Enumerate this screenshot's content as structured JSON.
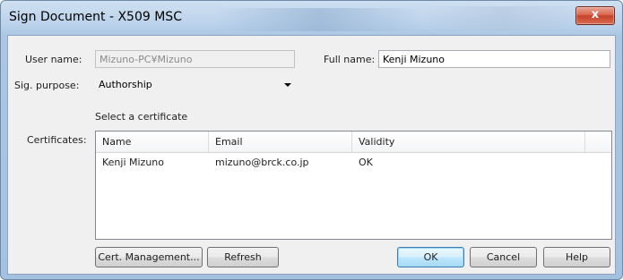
{
  "window": {
    "title": "Sign Document - X509 MSC",
    "close_glyph": "x"
  },
  "form": {
    "user_name_label": "User name:",
    "user_name_value": "Mizuno-PC¥Mizuno",
    "full_name_label": "Full name:",
    "full_name_value": "Kenji Mizuno",
    "sig_purpose_label": "Sig. purpose:",
    "sig_purpose_value": "Authorship",
    "select_certificate_label": "Select a certificate",
    "certificates_label": "Certificates:"
  },
  "certificates": {
    "columns": [
      "Name",
      "Email",
      "Validity"
    ],
    "rows": [
      {
        "name": "Kenji Mizuno",
        "email": "mizuno@brck.co.jp",
        "validity": "OK"
      }
    ]
  },
  "buttons": {
    "cert_management": "Cert. Management...",
    "refresh": "Refresh",
    "ok": "OK",
    "cancel": "Cancel",
    "help": "Help"
  }
}
